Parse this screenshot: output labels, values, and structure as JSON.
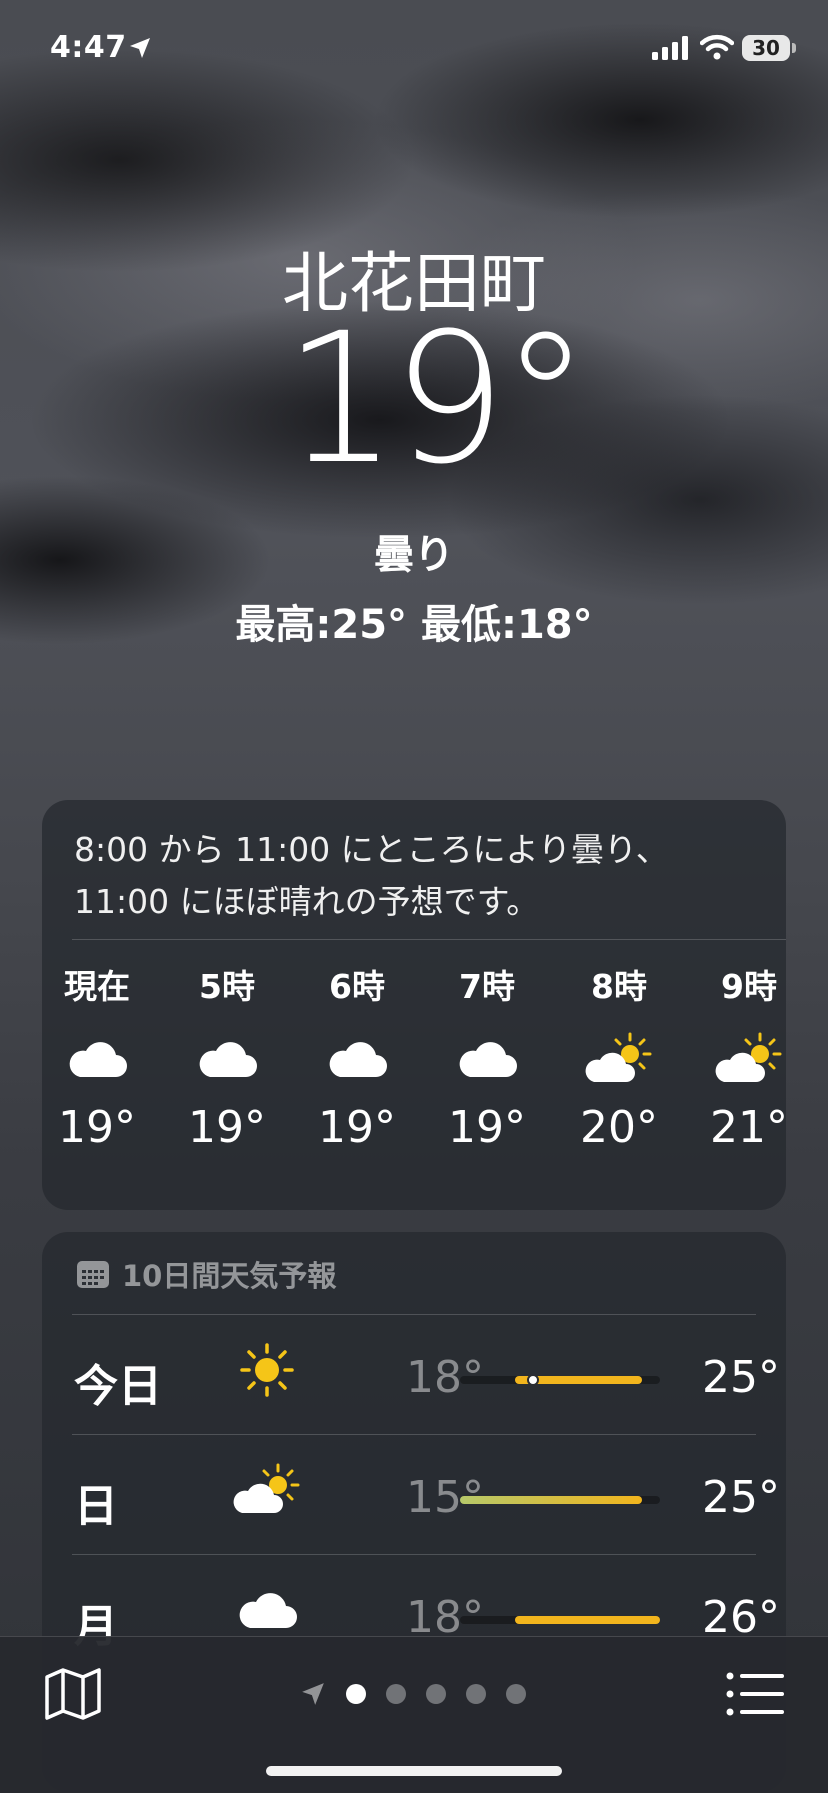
{
  "status_bar": {
    "time": "4:47",
    "battery": "30"
  },
  "location": {
    "city": "北花田町",
    "temperature": "19°",
    "condition": "曇り",
    "high_low": "最高:25°  最低:18°"
  },
  "hourly": {
    "summary_line1": "8:00 から 11:00 にところにより曇り、",
    "summary_line2": "11:00 にほぼ晴れの予想です。",
    "items": [
      {
        "label": "現在",
        "icon": "cloud-icon",
        "temp": "19°"
      },
      {
        "label": "5時",
        "icon": "cloud-icon",
        "temp": "19°"
      },
      {
        "label": "6時",
        "icon": "cloud-icon",
        "temp": "19°"
      },
      {
        "label": "7時",
        "icon": "cloud-icon",
        "temp": "19°"
      },
      {
        "label": "8時",
        "icon": "partly-sunny-icon",
        "temp": "20°"
      },
      {
        "label": "9時",
        "icon": "partly-sunny-icon",
        "temp": "21°"
      }
    ]
  },
  "daily": {
    "header": "10日間天気予報",
    "range_min": 15,
    "range_max": 26,
    "days": [
      {
        "name": "今日",
        "icon": "sun-icon",
        "low": "18°",
        "high": "25°",
        "low_value": 18,
        "high_value": 25,
        "current_value": 19
      },
      {
        "name": "日",
        "icon": "partly-sunny-icon",
        "low": "15°",
        "high": "25°",
        "low_value": 15,
        "high_value": 25
      },
      {
        "name": "月",
        "icon": "cloud-icon",
        "low": "18°",
        "high": "26°",
        "low_value": 18,
        "high_value": 26
      }
    ]
  },
  "colors": {
    "bar_cool": "#b6c86a",
    "bar_warm": "#f2b51d",
    "sun": "#f5c518"
  },
  "page_indicator": {
    "total_dots": 5,
    "active_index": 0
  }
}
